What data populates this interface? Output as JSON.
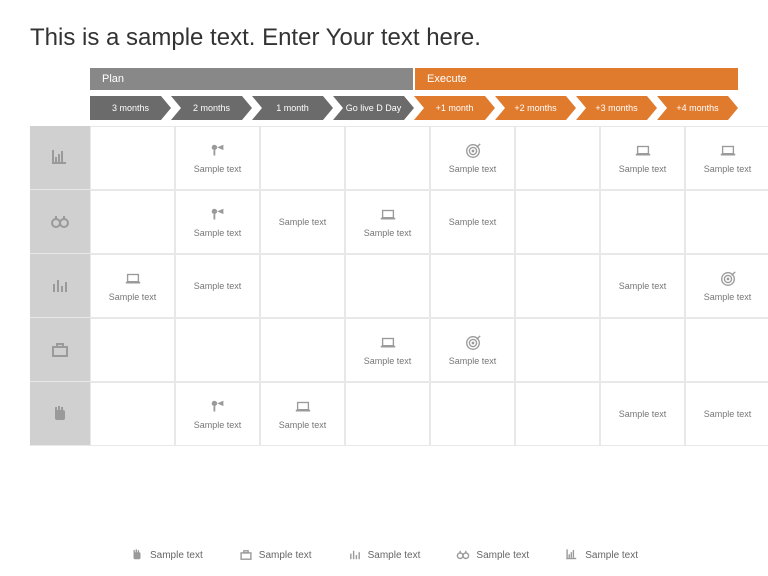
{
  "title": "This is a sample text. Enter Your text here.",
  "phases": {
    "plan": "Plan",
    "execute": "Execute"
  },
  "timeline": [
    "3 months",
    "2 months",
    "1 month",
    "Go live D Day",
    "+1 month",
    "+2 months",
    "+3 months",
    "+4 months"
  ],
  "chart_data": {
    "type": "table",
    "title": "Plan / Execute timeline matrix",
    "columns": [
      "3 months",
      "2 months",
      "1 month",
      "Go live D Day",
      "+1 month",
      "+2 months",
      "+3 months",
      "+4 months"
    ],
    "row_icons": [
      "chart-icon",
      "binoculars-icon",
      "bars-icon",
      "briefcase-icon",
      "fist-icon"
    ],
    "rows": [
      [
        null,
        {
          "icon": "megaphone-icon",
          "label": "Sample text"
        },
        null,
        null,
        {
          "icon": "target-icon",
          "label": "Sample text"
        },
        null,
        {
          "icon": "laptop-icon",
          "label": "Sample text"
        },
        {
          "icon": "laptop-icon",
          "label": "Sample text"
        }
      ],
      [
        null,
        {
          "icon": "megaphone-icon",
          "label": "Sample text"
        },
        {
          "label": "Sample text"
        },
        {
          "icon": "laptop-icon",
          "label": "Sample text"
        },
        {
          "label": "Sample text"
        },
        null,
        null,
        null
      ],
      [
        {
          "icon": "laptop-icon",
          "label": "Sample text"
        },
        {
          "label": "Sample text"
        },
        null,
        null,
        null,
        null,
        {
          "label": "Sample text"
        },
        {
          "icon": "target-icon",
          "label": "Sample text"
        }
      ],
      [
        null,
        null,
        null,
        {
          "icon": "laptop-icon",
          "label": "Sample text"
        },
        {
          "icon": "target-icon",
          "label": "Sample text"
        },
        null,
        null,
        null
      ],
      [
        null,
        {
          "icon": "megaphone-icon",
          "label": "Sample text"
        },
        {
          "icon": "laptop-icon",
          "label": "Sample text"
        },
        null,
        null,
        null,
        {
          "label": "Sample text"
        },
        {
          "label": "Sample text"
        }
      ]
    ]
  },
  "legend": [
    {
      "icon": "fist-icon",
      "label": "Sample text"
    },
    {
      "icon": "briefcase-icon",
      "label": "Sample text"
    },
    {
      "icon": "bars-icon",
      "label": "Sample text"
    },
    {
      "icon": "binoculars-icon",
      "label": "Sample text"
    },
    {
      "icon": "chart-icon",
      "label": "Sample text"
    }
  ],
  "colors": {
    "plan": "#6b6b6b",
    "execute": "#e07b2e",
    "grid": "#e8e8e8",
    "rowhead": "#d0d0d0"
  }
}
